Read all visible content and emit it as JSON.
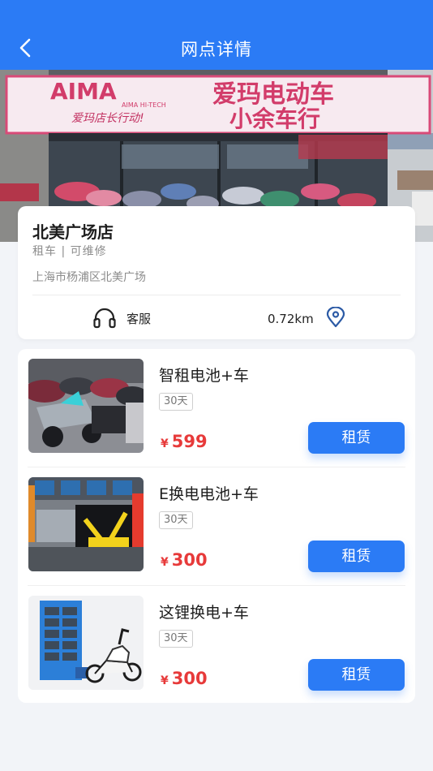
{
  "header": {
    "title": "网点详情",
    "back_icon": "chevron-left-icon",
    "background_color": "#2b7bf5"
  },
  "hero": {
    "sign_brand": "AIMA",
    "sign_brand_sub": "AIMA HI-TECH",
    "sign_line1": "爱玛电动车",
    "sign_line2": "小余车行",
    "sign_slogan": "爱玛店长行动!"
  },
  "store": {
    "name": "北美广场店",
    "tags": "租车 | 可维修",
    "address": "上海市杨浦区北美广场",
    "service_label": "客服",
    "service_icon": "headset-icon",
    "distance": "0.72km",
    "location_icon": "location-pin-icon"
  },
  "products": [
    {
      "name": "智租电池+车",
      "tag": "30天",
      "currency": "¥",
      "price": "599",
      "button": "租赁"
    },
    {
      "name": "E换电电池+车",
      "tag": "30天",
      "currency": "¥",
      "price": "300",
      "button": "租赁"
    },
    {
      "name": "这锂换电+车",
      "tag": "30天",
      "currency": "¥",
      "price": "300",
      "button": "租赁"
    }
  ],
  "colors": {
    "accent": "#2b7bf5",
    "price": "#e73a3a",
    "page_bg": "#f2f4f8"
  }
}
